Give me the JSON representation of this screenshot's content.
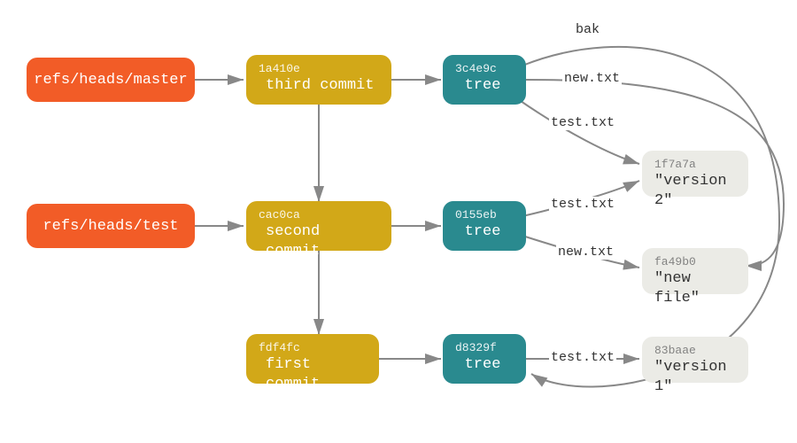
{
  "refs": [
    {
      "id": "ref-master",
      "label": "refs/heads/master"
    },
    {
      "id": "ref-test",
      "label": "refs/heads/test"
    }
  ],
  "commits": [
    {
      "id": "commit-third",
      "hash": "1a410e",
      "title": "third commit"
    },
    {
      "id": "commit-second",
      "hash": "cac0ca",
      "title": "second commit"
    },
    {
      "id": "commit-first",
      "hash": "fdf4fc",
      "title": "first commit"
    }
  ],
  "trees": [
    {
      "id": "tree-third",
      "hash": "3c4e9c",
      "title": "tree"
    },
    {
      "id": "tree-second",
      "hash": "0155eb",
      "title": "tree"
    },
    {
      "id": "tree-first",
      "hash": "d8329f",
      "title": "tree"
    }
  ],
  "blobs": [
    {
      "id": "blob-v2",
      "hash": "1f7a7a",
      "title": "\"version 2\""
    },
    {
      "id": "blob-new",
      "hash": "fa49b0",
      "title": "\"new file\""
    },
    {
      "id": "blob-v1",
      "hash": "83baae",
      "title": "\"version 1\""
    }
  ],
  "edge_labels": {
    "bak": "bak",
    "new1": "new.txt",
    "test1": "test.txt",
    "test2": "test.txt",
    "new2": "new.txt",
    "test3": "test.txt"
  }
}
